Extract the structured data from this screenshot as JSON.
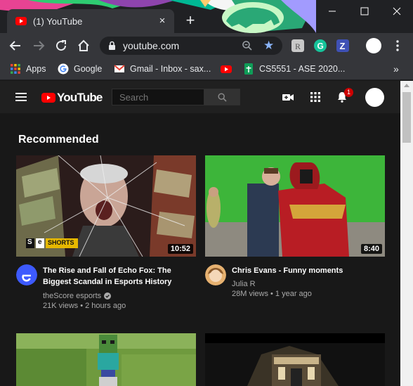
{
  "browser": {
    "tab": {
      "title": "(1) YouTube",
      "favicon": "youtube-favicon",
      "close_icon": "close-icon"
    },
    "new_tab_icon": "plus-icon",
    "window_controls": [
      "minimize-icon",
      "maximize-icon",
      "close-icon"
    ],
    "omnibox": {
      "url": "youtube.com",
      "lock_icon": "lock-icon",
      "zoom_icon": "zoom-icon",
      "bookmark_icon": "star-icon"
    },
    "bookmarks": [
      {
        "label": "Apps",
        "icon": "apps-grid-icon"
      },
      {
        "label": "Google",
        "icon": "google-icon"
      },
      {
        "label": "Gmail - Inbox - sax...",
        "icon": "gmail-icon"
      },
      {
        "label": "",
        "icon": "youtube-icon"
      },
      {
        "label": "CS5551 - ASE 2020...",
        "icon": "sheets-icon"
      }
    ],
    "bookmarks_overflow": "»",
    "colors": {
      "chrome_dark": "#202124",
      "toolbar": "#35363a",
      "accent_blue": "#8ab4f8"
    }
  },
  "youtube": {
    "logo_text": "YouTube",
    "search_placeholder": "Search",
    "notification_count": "1",
    "section_title": "Recommended",
    "colors": {
      "background": "#181818",
      "header": "#202020",
      "brand_red": "#ff0000",
      "badge_red": "#cc0000"
    },
    "videos": [
      {
        "title_line1": "The Rise and Fall of Echo Fox: The",
        "title_line2": "Biggest Scandal in Esports History",
        "channel": "theScore esports",
        "verified": true,
        "meta": "21K views • 2 hours ago",
        "duration": "10:52",
        "thumb_badge_left": "S",
        "thumb_badge_mid": "e",
        "thumb_badge_label": "SHORTS"
      },
      {
        "title_line1": "Chris Evans - Funny moments",
        "title_line2": "",
        "channel": "Julia R",
        "verified": false,
        "meta": "28M views • 1 year ago",
        "duration": "8:40"
      }
    ]
  }
}
